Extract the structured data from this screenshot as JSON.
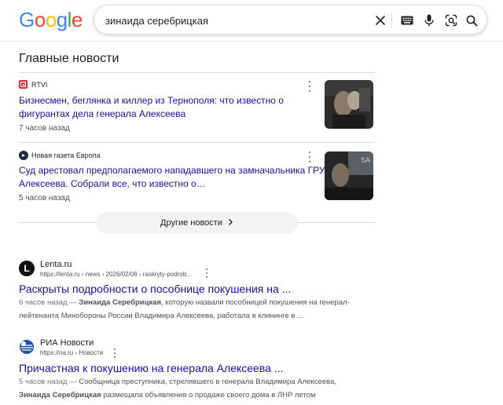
{
  "header": {
    "logo_letters": [
      {
        "ch": "G",
        "color": "#4285F4"
      },
      {
        "ch": "o",
        "color": "#EA4335"
      },
      {
        "ch": "o",
        "color": "#FBBC05"
      },
      {
        "ch": "g",
        "color": "#4285F4"
      },
      {
        "ch": "l",
        "color": "#34A853"
      },
      {
        "ch": "e",
        "color": "#EA4335"
      }
    ],
    "search_query": "зинаида серебрицкая",
    "icons": [
      "close-icon",
      "keyboard-icon",
      "microphone-icon",
      "google-lens-icon",
      "search-icon"
    ]
  },
  "top_stories": {
    "title": "Главные новости",
    "items": [
      {
        "source": "RTVI",
        "source_icon": "rtvi-logo",
        "title": "Бизнесмен, беглянка и киллер из Тернополя: что известно о фигурантах дела генерала Алексеева",
        "time": "7 часов назад",
        "thumbnail": "news-photo"
      },
      {
        "source": "Новая газета Европа",
        "source_icon": "novaya-gazeta-logo",
        "title": "Суд арестовал предполагаемого нападавшего на замначальника ГРУ Алексеева. Собрали все, что известно о…",
        "time": "5 часов назад",
        "thumbnail": "news-photo"
      }
    ],
    "more_label": "Другие новости"
  },
  "results": [
    {
      "site_name": "Lenta.ru",
      "favicon_letter": "L",
      "url": "https://lenta.ru › news › 2026/02/08 › raskryty-podrob…",
      "title": "Раскрыты подробности о пособнице покушения на ...",
      "snippet_meta": "6 часов назад — ",
      "snippet_bold": "Зинаида Серебрицкая",
      "snippet_rest": ", которую назвали пособницей покушения на генерал-лейтенанта Минобороны России Владимира Алексеева, работала в клининге в ..."
    },
    {
      "site_name": "РИА Новости",
      "favicon_letter": "",
      "url": "https://ria.ru › Новости",
      "title": "Причастная к покушению на генерала Алексеева ...",
      "snippet_meta": "5 часов назад — ",
      "snippet_pre": "Сообщница преступника, стрелявшего в генерала Владимира Алексеева,",
      "snippet_bold": "Зинаида Серебрицкая",
      "snippet_rest": " размещала объявления о продаже своего дома в ЛНР летом"
    }
  ]
}
